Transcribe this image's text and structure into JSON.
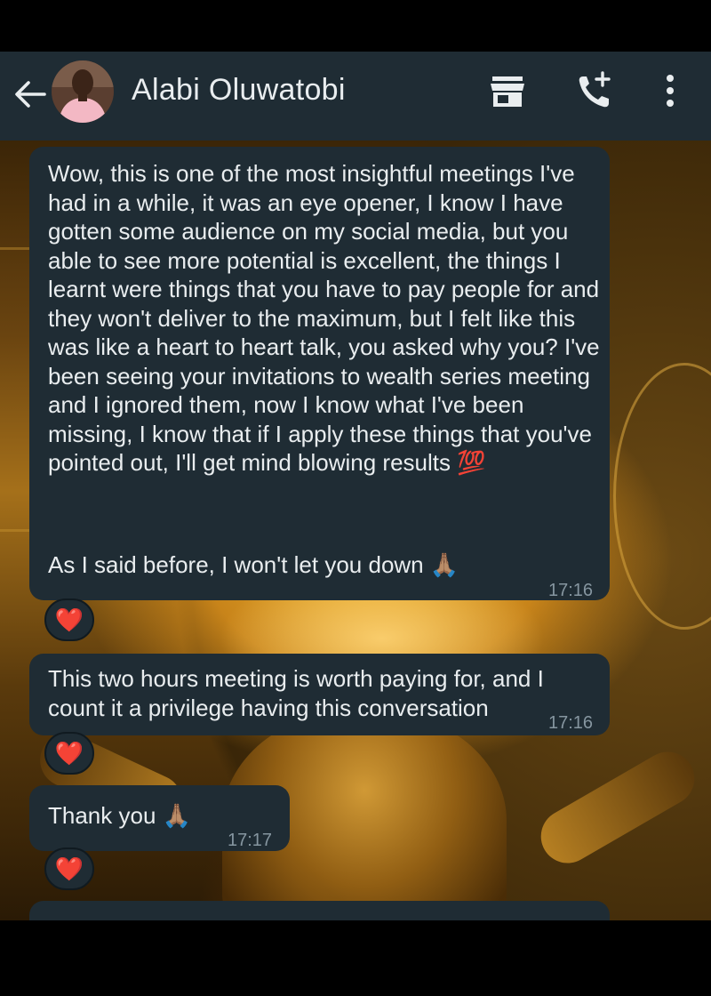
{
  "header": {
    "contact_name": "Alabi Oluwatobi",
    "bg_color": "#1f2c34",
    "text_color": "#e9edef"
  },
  "messages": [
    {
      "text": "Wow, this is one of the most insightful meetings I've had in a while, it was an eye opener, I know I have gotten some audience on my social media, but you able to see more potential is excellent, the things I learnt were things that you have to pay people for and they won't deliver to the maximum, but I felt like this was like a heart to heart talk, you asked why you? I've been seeing your invitations to wealth series meeting and I ignored them, now I know what I've been missing, I know that if I apply these things that you've pointed out, I'll get mind blowing results",
      "emoji": "💯",
      "text_2": "As I said before, I won't let you down",
      "emoji_2": "🙏🏽",
      "time": "17:16",
      "reaction": "❤️"
    },
    {
      "text": "This two hours meeting is worth paying for, and I count it a privilege having this conversation",
      "time": "17:16",
      "reaction": "❤️"
    },
    {
      "text": "Thank you",
      "emoji": "🙏🏽",
      "time": "17:17",
      "reaction": "❤️"
    }
  ],
  "icons": {
    "back": "arrow-left-icon",
    "catalog": "store-icon",
    "call": "add-call-icon",
    "menu": "more-vertical-icon"
  }
}
